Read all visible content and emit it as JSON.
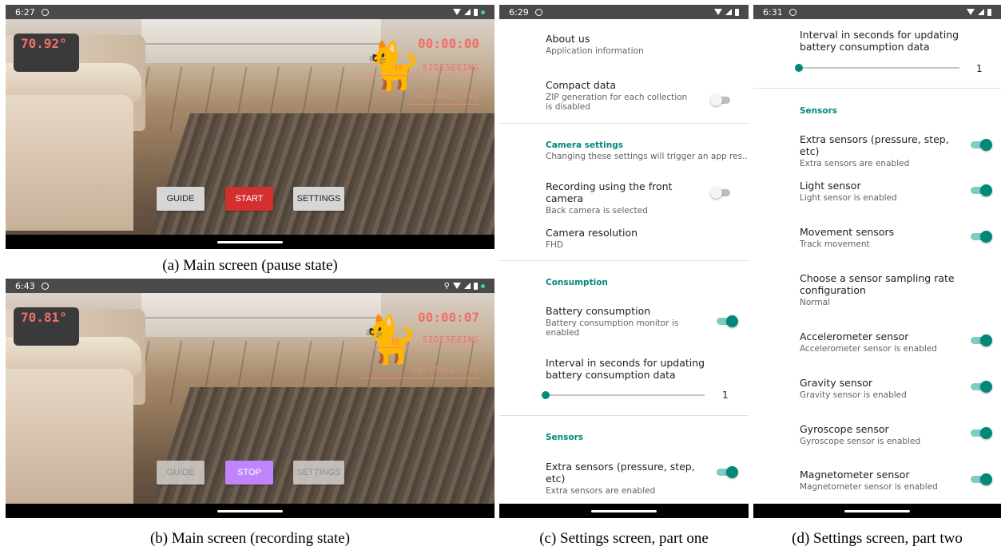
{
  "panel_a": {
    "status_time": "6:27",
    "temperature": "70.92°",
    "timer": "00:00:00",
    "app_label": "SIDESEEING",
    "instance_label": "INSTANCE 001",
    "buttons": {
      "guide": "GUIDE",
      "start": "START",
      "settings": "SETTINGS"
    },
    "caption": "(a) Main screen (pause state)"
  },
  "panel_b": {
    "status_time": "6:43",
    "temperature": "70.81°",
    "timer": "00:00:07",
    "app_label": "SIDESEEING",
    "instance_label": "INSTANCE 001",
    "buttons": {
      "guide": "GUIDE",
      "stop": "STOP",
      "settings": "SETTINGS"
    },
    "caption": "(b) Main screen (recording state)"
  },
  "panel_c": {
    "status_time": "6:29",
    "about_title": "About us",
    "about_sub": "Application information",
    "compact_title": "Compact data",
    "compact_sub": "ZIP generation for each collection is disabled",
    "camera_cat": "Camera settings",
    "camera_cat_sub": "Changing these settings will trigger an app res...",
    "front_cam_title": "Recording using the front camera",
    "front_cam_sub": "Back camera is selected",
    "resolution_title": "Camera resolution",
    "resolution_sub": "FHD",
    "consumption_cat": "Consumption",
    "battery_title": "Battery consumption",
    "battery_sub": "Battery consumption monitor is enabled",
    "interval_title": "Interval in seconds for updating battery consumption data",
    "interval_value": "1",
    "sensors_cat": "Sensors",
    "extra_title": "Extra sensors (pressure, step, etc)",
    "extra_sub": "Extra sensors are enabled",
    "caption": "(c) Settings screen, part one"
  },
  "panel_d": {
    "status_time": "6:31",
    "interval_title": "Interval in seconds for updating battery consumption data",
    "interval_value": "1",
    "sensors_cat": "Sensors",
    "extra_title": "Extra sensors (pressure, step, etc)",
    "extra_sub": "Extra sensors are enabled",
    "light_title": "Light sensor",
    "light_sub": "Light sensor is enabled",
    "movement_title": "Movement sensors",
    "movement_sub": "Track movement",
    "sampling_title": "Choose a sensor sampling rate configuration",
    "sampling_sub": "Normal",
    "accel_title": "Accelerometer sensor",
    "accel_sub": "Accelerometer sensor is enabled",
    "gravity_title": "Gravity sensor",
    "gravity_sub": "Gravity sensor is enabled",
    "gyro_title": "Gyroscope sensor",
    "gyro_sub": "Gyroscope sensor is enabled",
    "magneto_title": "Magnetometer sensor",
    "magneto_sub": "Magnetometer sensor is enabled",
    "caption": "(d) Settings screen, part two"
  },
  "toggle_states": {
    "compact_data": false,
    "front_camera": false,
    "battery_consumption": true,
    "extra_sensors": true,
    "light_sensor": true,
    "movement_sensors": true,
    "accelerometer": true,
    "gravity": true,
    "gyroscope": true,
    "magnetometer": true
  },
  "slider_fraction": 0,
  "colors": {
    "overlay_text": "#f07068",
    "accent_teal": "#00897b",
    "start_red": "#d32f2f",
    "stop_purple": "#c084fc",
    "status_bar": "#4a4a4a"
  },
  "icons": [
    "do-not-disturb-icon",
    "wifi-icon",
    "signal-icon",
    "battery-icon",
    "location-icon",
    "cat-figure"
  ]
}
